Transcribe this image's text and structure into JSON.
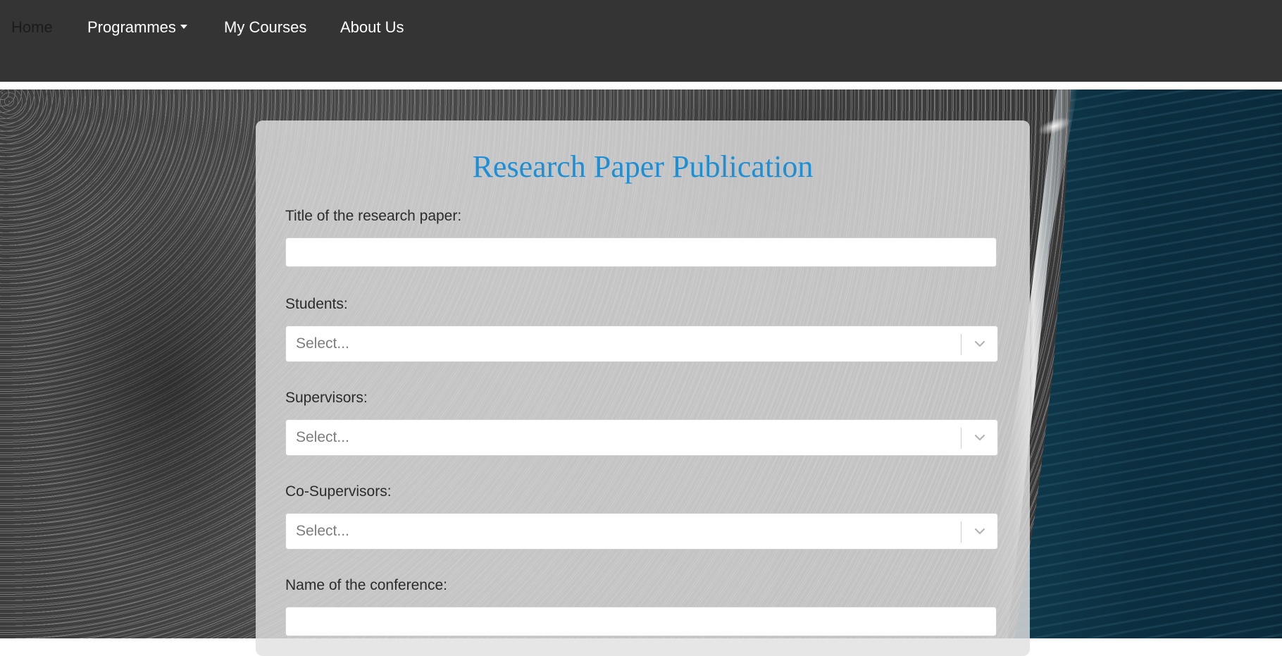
{
  "nav": {
    "home": "Home",
    "programmes": "Programmes",
    "my_courses": "My Courses",
    "about_us": "About Us"
  },
  "form": {
    "title": "Research Paper Publication",
    "paper_title_label": "Title of the research paper:",
    "paper_title_value": "",
    "students_label": "Students:",
    "students_placeholder": "Select...",
    "supervisors_label": "Supervisors:",
    "supervisors_placeholder": "Select...",
    "co_supervisors_label": "Co-Supervisors:",
    "co_supervisors_placeholder": "Select...",
    "conference_label": "Name of the conference:",
    "conference_value": ""
  },
  "colors": {
    "navbar_bg": "#343434",
    "title_color": "#1d8fd6",
    "card_bg": "#e1e1e1"
  },
  "icons": {
    "dropdown_caret": "caret-down-icon",
    "select_chevron": "chevron-down-icon"
  }
}
